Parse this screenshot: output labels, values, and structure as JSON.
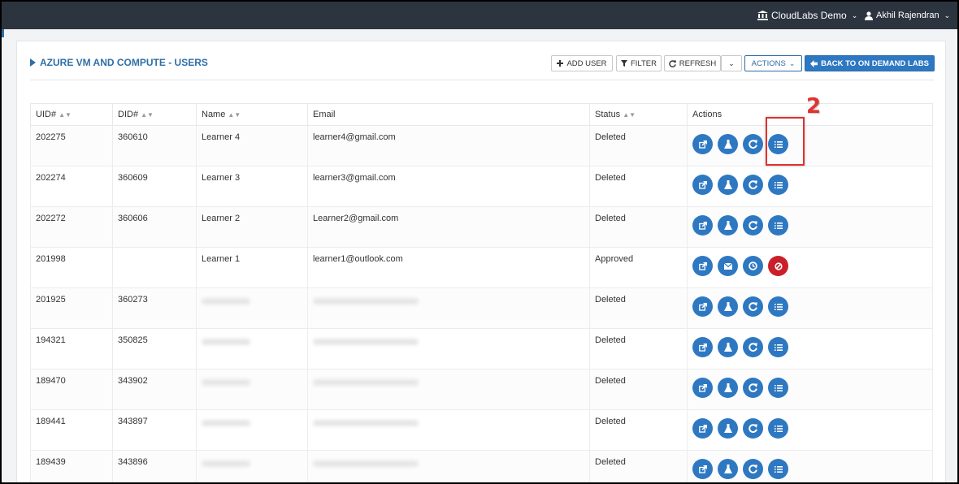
{
  "header": {
    "org_name": "CloudLabs Demo",
    "user_name": "Akhil Rajendran"
  },
  "page": {
    "title": "AZURE VM AND COMPUTE - USERS"
  },
  "toolbar": {
    "add_user": "ADD USER",
    "filter": "FILTER",
    "refresh": "REFRESH",
    "actions": "ACTIONS",
    "back": "BACK TO ON DEMAND LABS"
  },
  "table": {
    "columns": [
      "UID#",
      "DID#",
      "Name",
      "Email",
      "Status",
      "Actions"
    ],
    "rows": [
      {
        "uid": "202275",
        "did": "360610",
        "name": "Learner 4",
        "email": "learner4@gmail.com",
        "status": "Deleted",
        "actions": [
          "open-external",
          "lab",
          "refresh",
          "list"
        ]
      },
      {
        "uid": "202274",
        "did": "360609",
        "name": "Learner 3",
        "email": "learner3@gmail.com",
        "status": "Deleted",
        "actions": [
          "open-external",
          "lab",
          "refresh",
          "list"
        ]
      },
      {
        "uid": "202272",
        "did": "360606",
        "name": "Learner 2",
        "email": "Learner2@gmail.com",
        "status": "Deleted",
        "actions": [
          "open-external",
          "lab",
          "refresh",
          "list"
        ]
      },
      {
        "uid": "201998",
        "did": "",
        "name": "Learner 1",
        "email": "learner1@outlook.com",
        "status": "Approved",
        "actions": [
          "open-external",
          "email",
          "clock",
          "cancel"
        ]
      },
      {
        "uid": "201925",
        "did": "360273",
        "name": "",
        "email": "",
        "status": "Deleted",
        "actions": [
          "open-external",
          "lab",
          "refresh",
          "list"
        ]
      },
      {
        "uid": "194321",
        "did": "350825",
        "name": "",
        "email": "",
        "status": "Deleted",
        "actions": [
          "open-external",
          "lab",
          "refresh",
          "list"
        ]
      },
      {
        "uid": "189470",
        "did": "343902",
        "name": "",
        "email": "",
        "status": "Deleted",
        "actions": [
          "open-external",
          "lab",
          "refresh",
          "list"
        ]
      },
      {
        "uid": "189441",
        "did": "343897",
        "name": "",
        "email": "",
        "status": "Deleted",
        "actions": [
          "open-external",
          "lab",
          "refresh",
          "list"
        ]
      },
      {
        "uid": "189439",
        "did": "343896",
        "name": "",
        "email": "",
        "status": "Deleted",
        "actions": [
          "open-external",
          "lab",
          "refresh",
          "list"
        ]
      }
    ]
  },
  "annotation": {
    "callout_number": "2"
  },
  "colors": {
    "topbar": "#2c343f",
    "accent": "#2e78c2",
    "danger": "#c9202a",
    "annotation": "#e0322f"
  }
}
